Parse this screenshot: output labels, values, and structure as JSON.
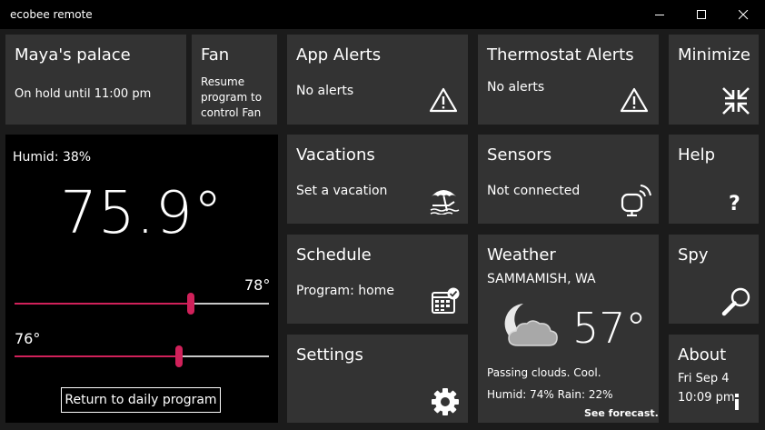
{
  "window": {
    "title": "ecobee remote"
  },
  "tiles": {
    "location": {
      "title": "Maya's palace",
      "status": "On hold until 11:00 pm"
    },
    "fan": {
      "title": "Fan",
      "line1": "Resume",
      "line2": "program to",
      "line3": "control Fan"
    },
    "app_alerts": {
      "title": "App Alerts",
      "status": "No alerts"
    },
    "thermostat_alerts": {
      "title": "Thermostat Alerts",
      "status": "No alerts"
    },
    "minimize": {
      "title": "Minimize"
    },
    "vacations": {
      "title": "Vacations",
      "status": "Set a vacation"
    },
    "sensors": {
      "title": "Sensors",
      "status": "Not connected"
    },
    "help": {
      "title": "Help"
    },
    "schedule": {
      "title": "Schedule",
      "status": "Program: home"
    },
    "weather": {
      "title": "Weather",
      "location": "SAMMAMISH, WA",
      "temperature": "57°",
      "condition": "Passing clouds. Cool.",
      "details": "Humid: 74% Rain: 22%",
      "forecast_link": "See forecast..."
    },
    "spy": {
      "title": "Spy"
    },
    "settings": {
      "title": "Settings"
    },
    "about": {
      "title": "About",
      "date": "Fri Sep 4",
      "time": "10:09 pm"
    }
  },
  "thermostat": {
    "humidity": "Humid: 38%",
    "current_temp": "75.9°",
    "cool_setpoint": "78°",
    "heat_setpoint": "76°",
    "cool_slider_level": 0.65,
    "heat_slider_level": 0.6,
    "return_button": "Return to daily program"
  },
  "colors": {
    "tile": "#333333",
    "accent": "#d0215a",
    "background": "#1b1b1b"
  },
  "icons": [
    "warning-icon",
    "minimize-icon",
    "beach-umbrella-icon",
    "sensor-icon",
    "help-icon",
    "calendar-icon",
    "cloud-moon-icon",
    "search-icon",
    "gear-icon",
    "info-icon"
  ]
}
